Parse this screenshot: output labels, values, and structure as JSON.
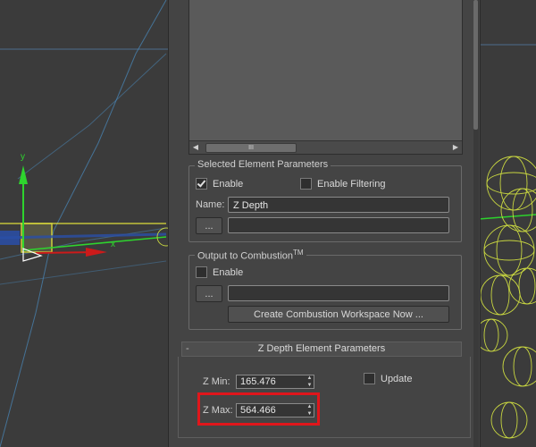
{
  "list": {
    "scroll_thumb_label": "III",
    "left_arrow_icon": "left-arrow-icon",
    "right_arrow_icon": "right-arrow-icon"
  },
  "selected_element": {
    "legend": "Selected Element Parameters",
    "enable_label": "Enable",
    "enable_checked": true,
    "enable_filtering_label": "Enable Filtering",
    "enable_filtering_checked": false,
    "name_label": "Name:",
    "name_value": "Z Depth",
    "browse_label": "...",
    "path_value": ""
  },
  "combustion": {
    "legend": "Output to Combustion",
    "legend_tm": "TM",
    "enable_label": "Enable",
    "enable_checked": false,
    "browse_label": "...",
    "path_value": "",
    "create_button_label": "Create Combustion Workspace Now ..."
  },
  "zdepth": {
    "rollout_sign": "-",
    "rollout_title": "Z Depth Element Parameters",
    "zmin_label": "Z Min:",
    "zmin_value": "165.476",
    "zmax_label": "Z Max:",
    "zmax_value": "564.466",
    "update_label": "Update",
    "update_checked": false
  },
  "viewport": {
    "axis_y_label": "y",
    "axis_x_label": "x"
  },
  "colors": {
    "highlight": "#e0161b",
    "viewport_bg": "#3a3a3a",
    "panel_bg": "#444444",
    "wire_yellow": "#c8d640"
  }
}
